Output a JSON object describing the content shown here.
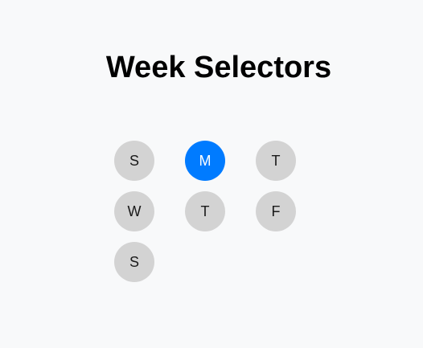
{
  "page": {
    "title": "Week Selectors"
  },
  "colors": {
    "background": "#f8f9fa",
    "day_default": "#d3d3d3",
    "day_selected": "#007bff",
    "day_selected_text": "#ffffff"
  },
  "days": [
    {
      "label": "S",
      "selected": false
    },
    {
      "label": "M",
      "selected": true
    },
    {
      "label": "T",
      "selected": false
    },
    {
      "label": "W",
      "selected": false
    },
    {
      "label": "T",
      "selected": false
    },
    {
      "label": "F",
      "selected": false
    },
    {
      "label": "S",
      "selected": false
    }
  ]
}
